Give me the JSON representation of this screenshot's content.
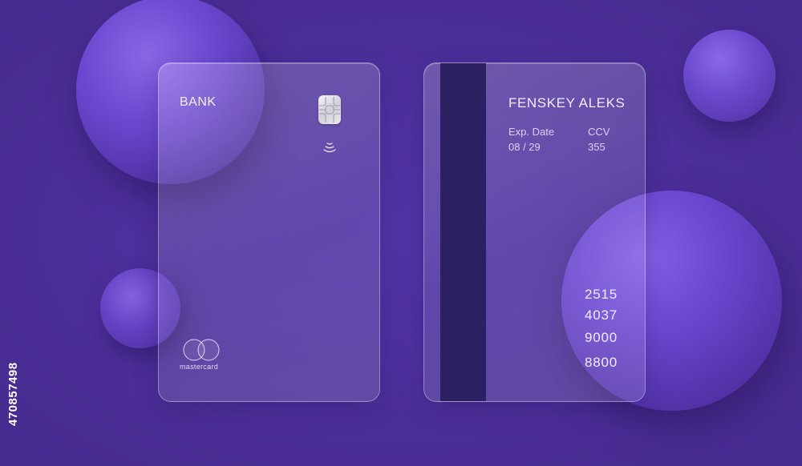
{
  "front_card": {
    "bank_label": "BANK",
    "network_name": "mastercard",
    "chip_icon": "emv-chip-icon",
    "contactless_icon": "contactless-icon",
    "network_logo_icon": "mastercard-circles-icon"
  },
  "back_card": {
    "holder_name": "FENSKEY ALEKS",
    "exp_label": "Exp. Date",
    "exp_value": "08 / 29",
    "ccv_label": "CCV",
    "ccv_value": "355",
    "number_groups": [
      "2515",
      "4037",
      "9000",
      "8800"
    ]
  },
  "image_id": "470857498",
  "colors": {
    "background": "#4b2f99",
    "sphere": "#6a46cf",
    "stripe": "#2c1f62",
    "text": "#f1ecff"
  }
}
